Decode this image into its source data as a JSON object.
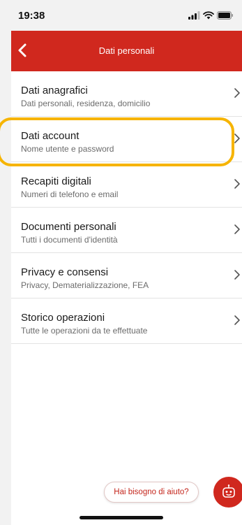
{
  "status_bar": {
    "time": "19:38"
  },
  "nav": {
    "title": "Dati personali"
  },
  "menu": [
    {
      "title": "Dati anagrafici",
      "subtitle": "Dati personali, residenza, domicilio"
    },
    {
      "title": "Dati account",
      "subtitle": "Nome utente e password"
    },
    {
      "title": "Recapiti digitali",
      "subtitle": "Numeri di telefono e email"
    },
    {
      "title": "Documenti personali",
      "subtitle": "Tutti i documenti d'identità"
    },
    {
      "title": "Privacy e consensi",
      "subtitle": "Privacy, Dematerializzazione, FEA"
    },
    {
      "title": "Storico operazioni",
      "subtitle": "Tutte le operazioni da te effettuate"
    }
  ],
  "help": {
    "label": "Hai bisogno di aiuto?"
  },
  "colors": {
    "brand_red": "#d0281e",
    "highlight": "#f6b400"
  },
  "icons": [
    "signal-icon",
    "wifi-icon",
    "battery-icon",
    "back-arrow-icon",
    "chevron-right-icon",
    "chatbot-icon"
  ]
}
